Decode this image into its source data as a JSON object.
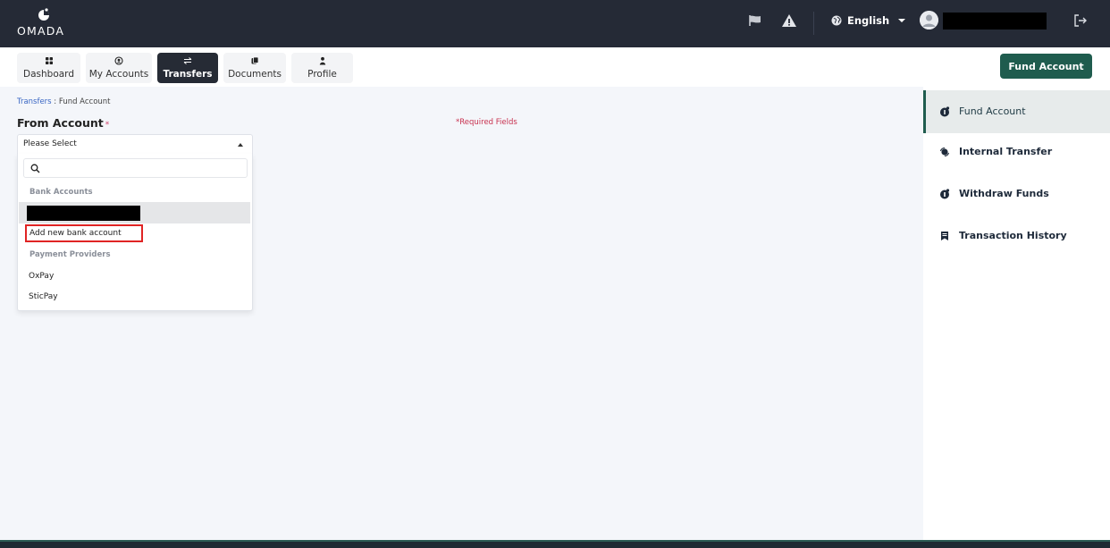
{
  "header": {
    "logo_text": "OMADA",
    "icons": [
      "flag-icon",
      "alert-icon",
      "globe-icon",
      "avatar-icon",
      "logout-icon"
    ],
    "language": "English"
  },
  "nav": {
    "items": [
      {
        "label": "Dashboard",
        "icon": "dashboard-icon"
      },
      {
        "label": "My Accounts",
        "icon": "accounts-icon"
      },
      {
        "label": "Transfers",
        "icon": "transfer-icon",
        "active": true
      },
      {
        "label": "Documents",
        "icon": "documents-icon"
      },
      {
        "label": "Profile",
        "icon": "profile-icon"
      }
    ],
    "fund_button": "Fund Account"
  },
  "breadcrumb": {
    "link": "Transfers",
    "separator": " : ",
    "current": "Fund Account"
  },
  "form": {
    "from_label": "From Account",
    "required_star": "*",
    "required_note": "*Required Fields",
    "select_value": "Please Select",
    "dropdown": {
      "search_placeholder": "",
      "group_bank": "Bank Accounts",
      "add_option": "Add new bank account",
      "group_providers": "Payment Providers",
      "providers": [
        "OxPay",
        "SticPay"
      ]
    }
  },
  "side_menu": {
    "items": [
      {
        "label": "Fund Account",
        "icon": "fund-icon",
        "active": true
      },
      {
        "label": "Internal Transfer",
        "icon": "internal-transfer-icon"
      },
      {
        "label": "Withdraw Funds",
        "icon": "withdraw-icon"
      },
      {
        "label": "Transaction History",
        "icon": "history-icon"
      }
    ]
  },
  "colors": {
    "topbar": "#252a36",
    "accent": "#1f5c4e",
    "link": "#3a67c4",
    "required": "#c8314f",
    "highlight_border": "#e02424"
  }
}
